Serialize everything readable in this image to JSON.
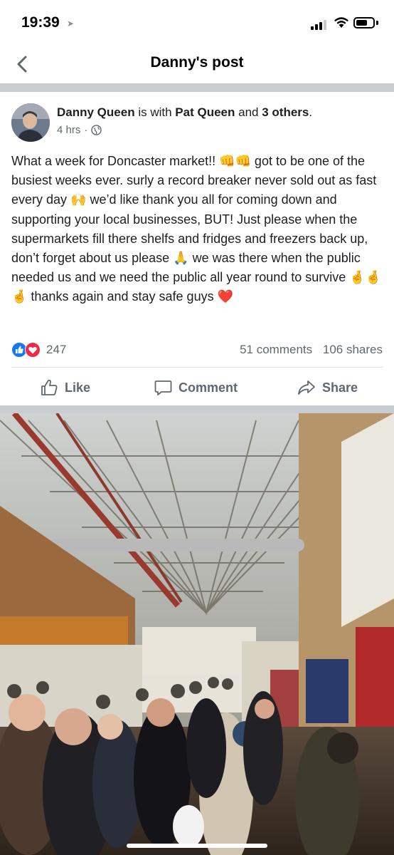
{
  "status_bar": {
    "time": "19:39",
    "battery_level": 0.7
  },
  "nav": {
    "title": "Danny's post",
    "back_icon": "chevron-left-icon"
  },
  "post": {
    "author": "Danny Queen",
    "with_text": "is with",
    "tagged": "Pat Queen",
    "and_text": "and",
    "others": "3 others",
    "end_dot": ".",
    "time": "4 hrs",
    "privacy_icon": "globe-icon",
    "text": "What a week for Doncaster market!! 👊👊 got to be one of the busiest weeks ever. surly a record breaker never sold out as fast every day 🙌 we’d like thank you all for coming down and supporting your local businesses, BUT! Just please when the supermarkets fill there shelfs and fridges and freezers back up, don’t forget about us please 🙏 we was there when the public needed us and we need the public all year round to survive 🤞🤞🤞 thanks again and stay safe guys ❤️",
    "reaction_count": "247",
    "comments": "51 comments",
    "shares": "106 shares"
  },
  "actions": {
    "like": "Like",
    "comment": "Comment",
    "share": "Share"
  },
  "colors": {
    "brand_blue": "#1877f2",
    "love_red": "#f02849",
    "secondary_text": "#606770",
    "divider": "#c9ccd1"
  }
}
